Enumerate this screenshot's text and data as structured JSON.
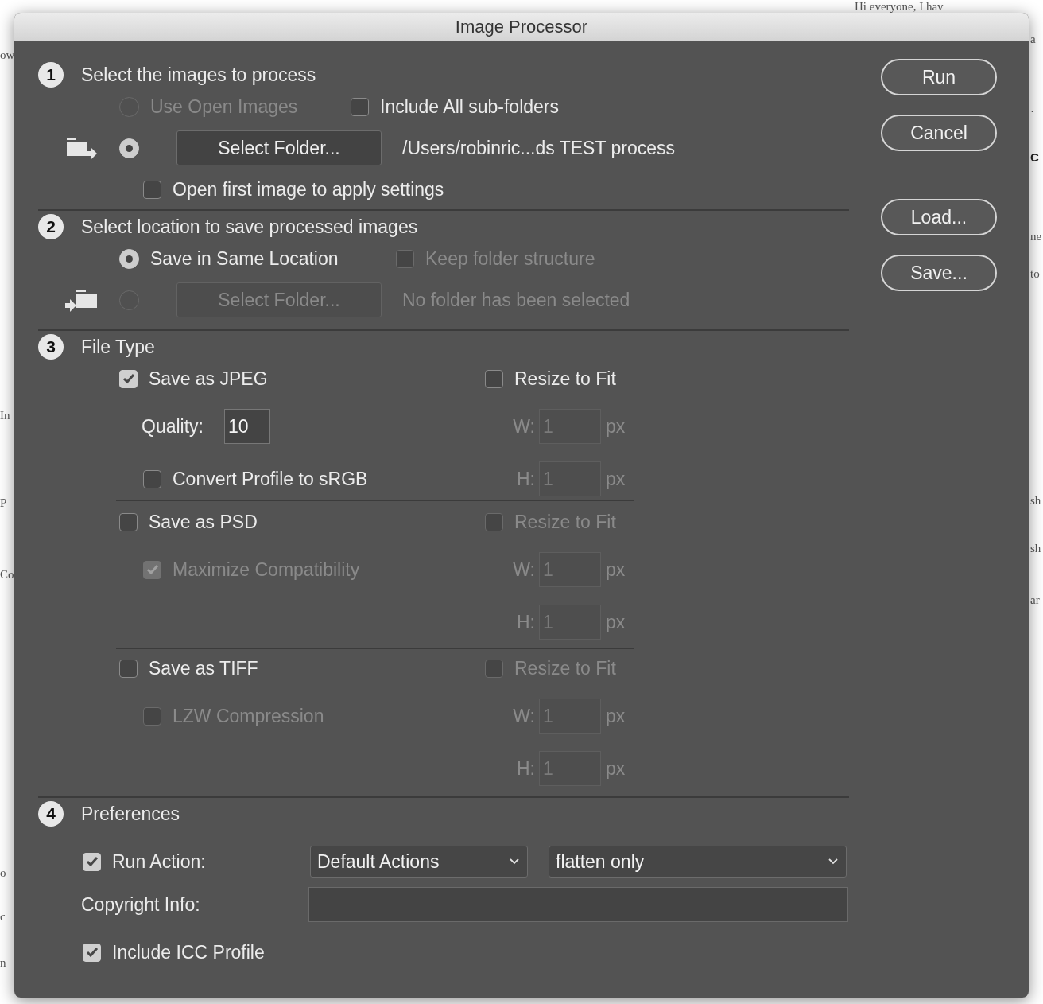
{
  "window": {
    "title": "Image Processor"
  },
  "background_text": {
    "top": "Hi everyone, I hav",
    "left": [
      "ow",
      "In",
      "P",
      "Co",
      "o",
      "c",
      "n"
    ],
    "right": [
      "a",
      "·",
      "C",
      "ne",
      "to",
      "sh",
      "sh",
      "ar"
    ]
  },
  "source": {
    "number": "1",
    "title": "Select the images to process",
    "use_open": {
      "label": "Use Open Images",
      "selected": false,
      "disabled": true
    },
    "include_subfolders": {
      "label": "Include All sub-folders",
      "checked": false,
      "disabled": false
    },
    "folder": {
      "selected": true,
      "disabled": false,
      "button": "Select Folder...",
      "path": "/Users/robinric...ds TEST process"
    },
    "open_first": {
      "label": "Open first image to apply settings",
      "checked": false,
      "disabled": false
    }
  },
  "destination": {
    "number": "2",
    "title": "Select location to save processed images",
    "same_location": {
      "label": "Save in Same Location",
      "selected": true,
      "disabled": false
    },
    "keep_structure": {
      "label": "Keep folder structure",
      "checked": false,
      "disabled": true
    },
    "folder": {
      "selected": false,
      "disabled": true,
      "button": "Select Folder...",
      "path": "No folder has been selected"
    }
  },
  "file_type": {
    "number": "3",
    "title": "File Type",
    "formats": [
      {
        "option": {
          "label": "Save as JPEG",
          "checked": true,
          "disabled": false
        },
        "settings": [
          {
            "kind": "quality",
            "label": "Quality:",
            "value": "10",
            "disabled": false
          },
          {
            "kind": "checkbox",
            "label": "Convert Profile to sRGB",
            "checked": false,
            "disabled": false
          }
        ],
        "resize": {
          "label": "Resize to Fit",
          "checked": false,
          "disabled": false
        },
        "width": {
          "label": "W:",
          "value": "1",
          "unit": "px",
          "disabled": true
        },
        "height": {
          "label": "H:",
          "value": "1",
          "unit": "px",
          "disabled": true
        }
      },
      {
        "option": {
          "label": "Save as PSD",
          "checked": false,
          "disabled": false
        },
        "settings": [
          {
            "kind": "checkbox",
            "label": "Maximize Compatibility",
            "checked": true,
            "disabled": true
          }
        ],
        "resize": {
          "label": "Resize to Fit",
          "checked": false,
          "disabled": true
        },
        "width": {
          "label": "W:",
          "value": "1",
          "unit": "px",
          "disabled": true
        },
        "height": {
          "label": "H:",
          "value": "1",
          "unit": "px",
          "disabled": true
        }
      },
      {
        "option": {
          "label": "Save as TIFF",
          "checked": false,
          "disabled": false
        },
        "settings": [
          {
            "kind": "checkbox",
            "label": "LZW Compression",
            "checked": false,
            "disabled": true
          }
        ],
        "resize": {
          "label": "Resize to Fit",
          "checked": false,
          "disabled": true
        },
        "width": {
          "label": "W:",
          "value": "1",
          "unit": "px",
          "disabled": true
        },
        "height": {
          "label": "H:",
          "value": "1",
          "unit": "px",
          "disabled": true
        }
      }
    ]
  },
  "preferences": {
    "number": "4",
    "title": "Preferences",
    "run_action": {
      "label": "Run Action:",
      "checked": true,
      "disabled": false
    },
    "action_set": "Default Actions",
    "action": "flatten only",
    "copyright": {
      "label": "Copyright Info:"
    },
    "include_icc": {
      "label": "Include ICC Profile",
      "checked": true,
      "disabled": false
    }
  },
  "button_groups": [
    [
      "Run",
      "Cancel"
    ],
    [
      "Load...",
      "Save..."
    ]
  ]
}
